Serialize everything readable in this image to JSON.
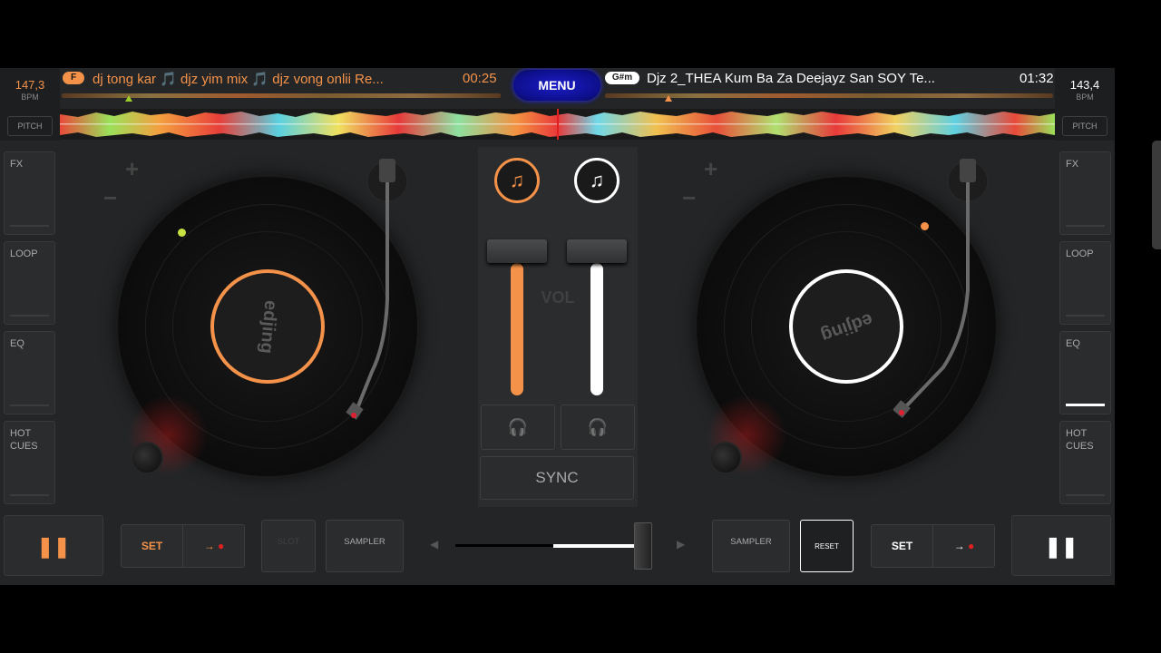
{
  "colors": {
    "deck_a_accent": "#f4924a",
    "deck_b_accent": "#ffffff",
    "menu_blue": "#1214b8",
    "background": "#232527"
  },
  "deck_a": {
    "bpm": "147,3",
    "bpm_unit": "BPM",
    "pitch_label": "PITCH",
    "key": "F",
    "title": "dj tong kar 🎵 djz yim mix 🎵 djz vong onlii Re...",
    "time": "00:25",
    "side_buttons": [
      "FX",
      "LOOP",
      "EQ",
      "HOT CUES"
    ],
    "label_text": "edjing",
    "play_icon": "pause-icon"
  },
  "deck_b": {
    "bpm": "143,4",
    "bpm_unit": "BPM",
    "pitch_label": "PITCH",
    "key": "G#m",
    "title": "Djz 2_THEA  Kum Ba Za  Deejayz San SOY Te...",
    "time": "01:32",
    "side_buttons": [
      "FX",
      "LOOP",
      "EQ",
      "HOT CUES"
    ],
    "label_text": "edjing",
    "play_icon": "pause-icon"
  },
  "menu_label": "MENU",
  "mixer": {
    "vol_label": "VOL",
    "sync_label": "SYNC",
    "volume_a": 0.85,
    "volume_b": 0.85
  },
  "bottom": {
    "set_label": "SET",
    "sampler_label": "SAMPLER",
    "reset_label": "RESET",
    "slot_label": "SLOT",
    "crossfader_position": 0.95
  }
}
